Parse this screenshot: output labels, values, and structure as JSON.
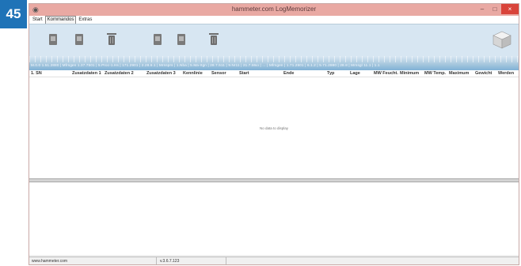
{
  "badge": "45",
  "window": {
    "title": "hammeter.com LogMemorizer",
    "controls": {
      "minimize": "–",
      "maximize": "□",
      "close": "×"
    }
  },
  "menu": {
    "tabs": [
      "Start",
      "Kommandos",
      "Extras"
    ],
    "active": "Kommandos"
  },
  "ribbon": {
    "buttons": [
      {
        "icon": "device-read-icon"
      },
      {
        "icon": "device-write-icon"
      },
      {
        "icon": "delete-icon"
      },
      {
        "icon": "device-read-icon"
      },
      {
        "icon": "device-write-icon"
      },
      {
        "icon": "delete-icon"
      }
    ],
    "right_icon": "cube-3d-icon"
  },
  "scale": {
    "text": "M.0.0 1.51.2880  | Mfrsgen 1.37.7501 | 5.Proc-1.Hs | 171.2901 | 2.28.6.1  | Mrnsprs | 1.Nba | 5.Ma-Itgn | 28.7.511 | 9.Nr11 | 21.7.Mso | ... | Mfrsgen | 1.71.2501 | 6.1.2 | 5.71.2880 | 28.8 | Mrnsgl 11.1 | 1.1"
  },
  "grid": {
    "columns": [
      "1. SN",
      "Zusatzdaten 1",
      "Zusatzdaten 2",
      "Zusatzdaten 3",
      "Kennlinie",
      "Sensor",
      "Start",
      "Ende",
      "Typ",
      "Lage",
      "MW Feucht.",
      "Minimum",
      "MW Temp.",
      "Maximum",
      "Gewicht",
      "Werden"
    ],
    "empty_text": "No data to display"
  },
  "status": {
    "url": "www.hammeter.com",
    "version": "v.3.6.7.123"
  }
}
